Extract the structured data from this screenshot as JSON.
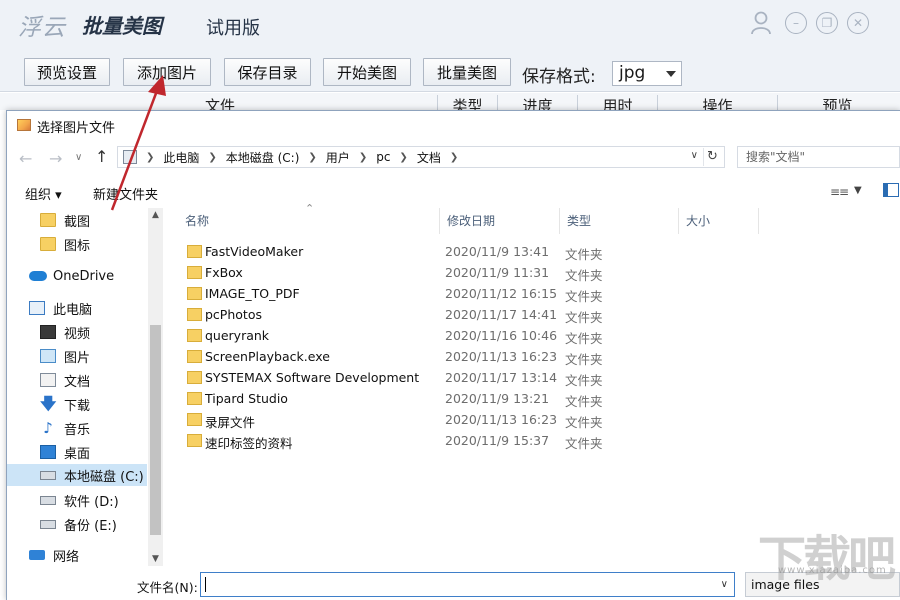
{
  "app": {
    "logo_text": "浮云",
    "name": "批量美图",
    "edition": "试用版"
  },
  "toolbar": {
    "buttons": [
      "预览设置",
      "添加图片",
      "保存目录",
      "开始美图",
      "批量美图"
    ],
    "format_label": "保存格式:",
    "format_value": "jpg"
  },
  "table": {
    "columns": [
      "文件",
      "类型",
      "进度",
      "用时",
      "操作",
      "预览"
    ]
  },
  "dialog": {
    "title": "选择图片文件",
    "breadcrumbs": [
      "此电脑",
      "本地磁盘 (C:)",
      "用户",
      "pc",
      "文档"
    ],
    "search_placeholder": "搜索\"文档\"",
    "commands": {
      "organize": "组织 ▾",
      "new_folder": "新建文件夹"
    },
    "nav_items": [
      {
        "label": "截图",
        "icon": "folder-icon"
      },
      {
        "label": "图标",
        "icon": "folder-icon"
      },
      {
        "label": "OneDrive",
        "icon": "cloud-icon"
      },
      {
        "label": "此电脑",
        "icon": "computer-icon"
      },
      {
        "label": "视频",
        "icon": "video-icon"
      },
      {
        "label": "图片",
        "icon": "pictures-icon"
      },
      {
        "label": "文档",
        "icon": "documents-icon"
      },
      {
        "label": "下载",
        "icon": "download-icon"
      },
      {
        "label": "音乐",
        "icon": "music-icon"
      },
      {
        "label": "桌面",
        "icon": "desktop-icon"
      },
      {
        "label": "本地磁盘 (C:)",
        "icon": "drive-icon"
      },
      {
        "label": "软件 (D:)",
        "icon": "drive-icon"
      },
      {
        "label": "备份 (E:)",
        "icon": "drive-icon"
      },
      {
        "label": "网络",
        "icon": "network-icon"
      }
    ],
    "columns": [
      "名称",
      "修改日期",
      "类型",
      "大小"
    ],
    "files": [
      {
        "name": "FastVideoMaker",
        "date": "2020/11/9 13:41",
        "type": "文件夹"
      },
      {
        "name": "FxBox",
        "date": "2020/11/9 11:31",
        "type": "文件夹"
      },
      {
        "name": "IMAGE_TO_PDF",
        "date": "2020/11/12 16:15",
        "type": "文件夹"
      },
      {
        "name": "pcPhotos",
        "date": "2020/11/17 14:41",
        "type": "文件夹"
      },
      {
        "name": "queryrank",
        "date": "2020/11/16 10:46",
        "type": "文件夹"
      },
      {
        "name": "ScreenPlayback.exe",
        "date": "2020/11/13 16:23",
        "type": "文件夹"
      },
      {
        "name": "SYSTEMAX Software Development",
        "date": "2020/11/17 13:14",
        "type": "文件夹"
      },
      {
        "name": "Tipard Studio",
        "date": "2020/11/9 13:21",
        "type": "文件夹"
      },
      {
        "name": "录屏文件",
        "date": "2020/11/13 16:23",
        "type": "文件夹"
      },
      {
        "name": "速印标签的资料",
        "date": "2020/11/9 15:37",
        "type": "文件夹"
      }
    ],
    "filename_label": "文件名(N):",
    "filename_value": "",
    "filter_label": "image files"
  },
  "watermark": {
    "text": "下载吧",
    "url": "www.xiazaiba.com"
  }
}
